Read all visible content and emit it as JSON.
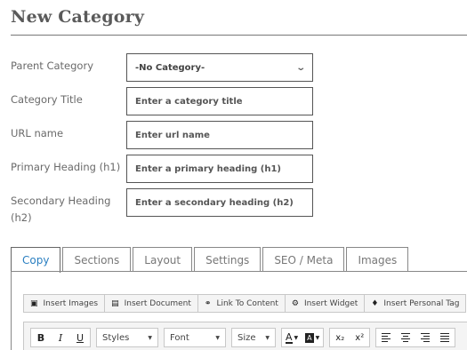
{
  "page": {
    "title": "New Category"
  },
  "form": {
    "parent_category": {
      "label": "Parent Category",
      "value": "-No Category-"
    },
    "category_title": {
      "label": "Category Title",
      "placeholder": "Enter a category title"
    },
    "url_name": {
      "label": "URL name",
      "placeholder": "Enter url name"
    },
    "primary_heading": {
      "label": "Primary Heading (h1)",
      "placeholder": "Enter a primary heading (h1)"
    },
    "secondary_heading": {
      "label_line1": "Secondary Heading",
      "label_line2": "(h2)",
      "placeholder": "Enter a secondary heading (h2)"
    }
  },
  "tabs": [
    {
      "label": "Copy",
      "active": true
    },
    {
      "label": "Sections"
    },
    {
      "label": "Layout"
    },
    {
      "label": "Settings"
    },
    {
      "label": "SEO / Meta"
    },
    {
      "label": "Images"
    }
  ],
  "editor_toolbar": {
    "insert_images": "Insert Images",
    "insert_document": "Insert Document",
    "link_to_content": "Link To Content",
    "insert_widget": "Insert Widget",
    "insert_personal_tag": "Insert Personal Tag"
  },
  "format_toolbar": {
    "bold": "B",
    "italic": "I",
    "underline": "U",
    "styles": "Styles",
    "font": "Font",
    "size": "Size",
    "text_color": "A",
    "bg_color": "A",
    "subscript": "x₂",
    "superscript": "x²"
  },
  "colors": {
    "accent": "#2a7fc1",
    "border": "#888888",
    "toolbar_bg": "#f4f4f4"
  },
  "icons": [
    "camera-icon",
    "document-icon",
    "link-icon",
    "gear-icon",
    "tag-icon",
    "chevron-down-icon",
    "align-left-icon",
    "align-center-icon",
    "align-right-icon",
    "align-justify-icon"
  ]
}
